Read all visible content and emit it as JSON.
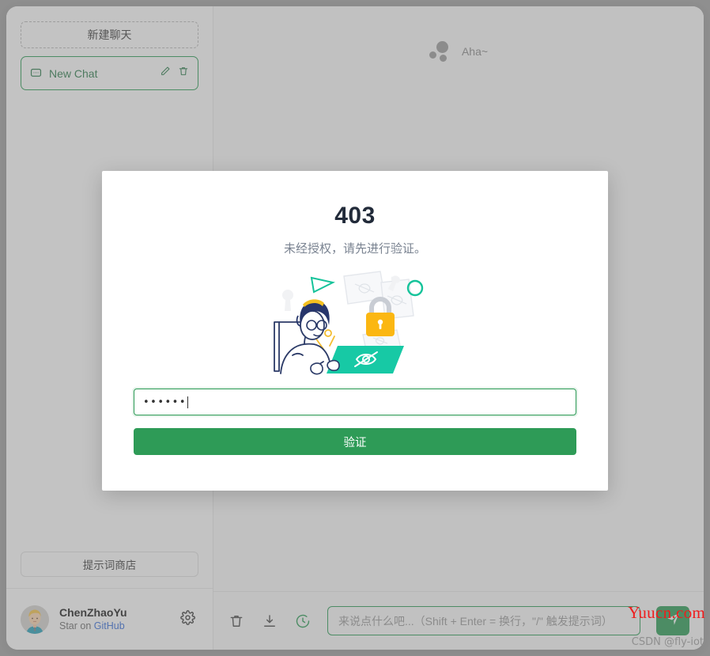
{
  "sidebar": {
    "new_chat_label": "新建聊天",
    "chats": [
      {
        "label": "New Chat",
        "icon": "message-square-icon",
        "edit_icon": "pencil-icon",
        "delete_icon": "trash-icon"
      }
    ],
    "store_label": "提示词商店",
    "user": {
      "name": "ChenZhaoYu",
      "sub_prefix": "Star on ",
      "sub_link": "GitHub",
      "avatar": "user-avatar",
      "settings_icon": "gear-icon"
    }
  },
  "main": {
    "messages": [
      {
        "author": "assistant",
        "text": "Aha~"
      }
    ],
    "compose": {
      "tools": [
        {
          "name": "clear-conversation-icon"
        },
        {
          "name": "export-download-icon"
        },
        {
          "name": "history-clock-icon"
        }
      ],
      "placeholder": "来说点什么吧...（Shift + Enter = 换行，\"/\" 触发提示词）",
      "send_icon": "send-plane-icon"
    }
  },
  "modal": {
    "code": "403",
    "subtitle": "未经授权，请先进行验证。",
    "illustration": "unauthorized-person-laptop-lock-illustration",
    "input_value": "••••••",
    "verify_label": "验证"
  },
  "watermarks": {
    "red": "Yuucn.com",
    "gray": "CSDN @fly-iot"
  },
  "colors": {
    "accent_green": "#2e9b57",
    "link_blue": "#3a6fd8",
    "code_navy": "#222b3a",
    "watermark_red": "#ef1c1c"
  }
}
